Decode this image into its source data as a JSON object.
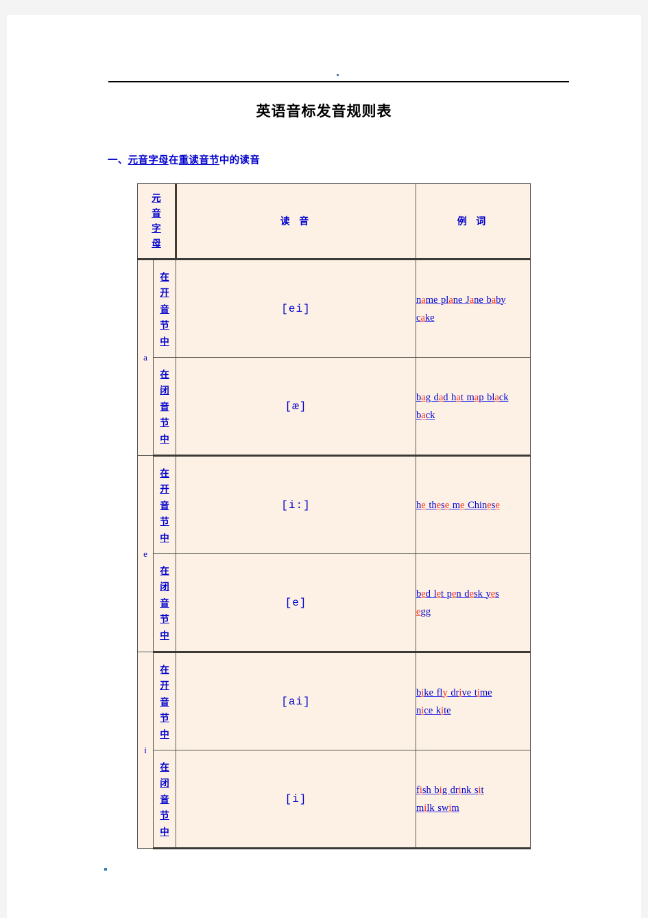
{
  "document": {
    "title": "英语音标发音规则表",
    "section_heading": {
      "prefix": "一、",
      "u1": "元音字母",
      "mid": "在",
      "u2": "重读音节",
      "suffix": "中的读音"
    }
  },
  "table": {
    "headers": {
      "vowel_letter_vertical": [
        "元",
        "音",
        "字",
        "母"
      ],
      "pronunciation": "读 音",
      "examples": "例 词"
    },
    "rows": [
      {
        "letter": "a",
        "syllable_vertical": [
          "在",
          "开",
          "音",
          "节",
          "中"
        ],
        "syllable_text": "在开音节中",
        "phonetic": "[ei]",
        "examples": [
          [
            {
              "t": "n",
              "c": "blue"
            },
            {
              "t": "a",
              "c": "red"
            },
            {
              "t": "me pl",
              "c": "blue"
            },
            {
              "t": "a",
              "c": "red"
            },
            {
              "t": "ne J",
              "c": "blue"
            },
            {
              "t": "a",
              "c": "red"
            },
            {
              "t": "ne b",
              "c": "blue"
            },
            {
              "t": "a",
              "c": "red"
            },
            {
              "t": "by",
              "c": "blue"
            }
          ],
          [
            {
              "t": "c",
              "c": "blue"
            },
            {
              "t": "a",
              "c": "red"
            },
            {
              "t": "ke",
              "c": "blue"
            }
          ]
        ],
        "examples_text": "name plane Jane baby cake"
      },
      {
        "letter": "",
        "syllable_vertical": [
          "在",
          "闭",
          "音",
          "节",
          "中"
        ],
        "syllable_text": "在闭音节中",
        "phonetic": "[æ]",
        "examples": [
          [
            {
              "t": "b",
              "c": "blue"
            },
            {
              "t": "a",
              "c": "red"
            },
            {
              "t": "g d",
              "c": "blue"
            },
            {
              "t": "a",
              "c": "red"
            },
            {
              "t": "d h",
              "c": "blue"
            },
            {
              "t": "a",
              "c": "red"
            },
            {
              "t": "t m",
              "c": "blue"
            },
            {
              "t": "a",
              "c": "red"
            },
            {
              "t": "p bl",
              "c": "blue"
            },
            {
              "t": "a",
              "c": "red"
            },
            {
              "t": "ck",
              "c": "blue"
            }
          ],
          [
            {
              "t": "b",
              "c": "blue"
            },
            {
              "t": "a",
              "c": "red"
            },
            {
              "t": "ck",
              "c": "blue"
            }
          ]
        ],
        "examples_text": "bag dad hat map black back"
      },
      {
        "letter": "e",
        "syllable_vertical": [
          "在",
          "开",
          "音",
          "节",
          "中"
        ],
        "syllable_text": "在开音节中",
        "phonetic": "[i:]",
        "examples": [
          [
            {
              "t": "h",
              "c": "blue"
            },
            {
              "t": "e",
              "c": "red"
            },
            {
              "t": " th",
              "c": "blue"
            },
            {
              "t": "e",
              "c": "red"
            },
            {
              "t": "s",
              "c": "blue"
            },
            {
              "t": "e",
              "c": "red"
            },
            {
              "t": " m",
              "c": "blue"
            },
            {
              "t": "e",
              "c": "red"
            },
            {
              "t": " Chin",
              "c": "blue"
            },
            {
              "t": "e",
              "c": "red"
            },
            {
              "t": "s",
              "c": "blue"
            },
            {
              "t": "e",
              "c": "red"
            }
          ]
        ],
        "examples_text": "he these me Chinese"
      },
      {
        "letter": "",
        "syllable_vertical": [
          "在",
          "闭",
          "音",
          "节",
          "中"
        ],
        "syllable_text": "在闭音节中",
        "phonetic": "[e]",
        "examples": [
          [
            {
              "t": "b",
              "c": "blue"
            },
            {
              "t": "e",
              "c": "red"
            },
            {
              "t": "d l",
              "c": "blue"
            },
            {
              "t": "e",
              "c": "red"
            },
            {
              "t": "t p",
              "c": "blue"
            },
            {
              "t": "e",
              "c": "red"
            },
            {
              "t": "n d",
              "c": "blue"
            },
            {
              "t": "e",
              "c": "red"
            },
            {
              "t": "sk y",
              "c": "blue"
            },
            {
              "t": "e",
              "c": "red"
            },
            {
              "t": "s",
              "c": "blue"
            }
          ],
          [
            {
              "t": "e",
              "c": "red"
            },
            {
              "t": "gg",
              "c": "blue"
            }
          ]
        ],
        "examples_text": "bed let pen desk yes egg"
      },
      {
        "letter": "i",
        "syllable_vertical": [
          "在",
          "开",
          "音",
          "节",
          "中"
        ],
        "syllable_text": "在开音节中",
        "phonetic": "[ai]",
        "examples": [
          [
            {
              "t": "b",
              "c": "blue"
            },
            {
              "t": "i",
              "c": "red"
            },
            {
              "t": "ke fl",
              "c": "blue"
            },
            {
              "t": "y",
              "c": "red"
            },
            {
              "t": " dr",
              "c": "blue"
            },
            {
              "t": "i",
              "c": "red"
            },
            {
              "t": "ve t",
              "c": "blue"
            },
            {
              "t": "i",
              "c": "red"
            },
            {
              "t": "me",
              "c": "blue"
            }
          ],
          [
            {
              "t": "n",
              "c": "blue"
            },
            {
              "t": "i",
              "c": "red"
            },
            {
              "t": "ce k",
              "c": "blue"
            },
            {
              "t": "i",
              "c": "red"
            },
            {
              "t": "te",
              "c": "blue"
            }
          ]
        ],
        "examples_text": "bike fly drive time nice kite"
      },
      {
        "letter": "",
        "syllable_vertical": [
          "在",
          "闭",
          "音",
          "节",
          "中"
        ],
        "syllable_text": "在闭音节中",
        "phonetic": "[i]",
        "examples": [
          [
            {
              "t": "f",
              "c": "blue"
            },
            {
              "t": "i",
              "c": "red"
            },
            {
              "t": "sh b",
              "c": "blue"
            },
            {
              "t": "i",
              "c": "red"
            },
            {
              "t": "g dr",
              "c": "blue"
            },
            {
              "t": "i",
              "c": "red"
            },
            {
              "t": "nk s",
              "c": "blue"
            },
            {
              "t": "i",
              "c": "red"
            },
            {
              "t": "t",
              "c": "blue"
            }
          ],
          [
            {
              "t": "m",
              "c": "blue"
            },
            {
              "t": "i",
              "c": "red"
            },
            {
              "t": "lk sw",
              "c": "blue"
            },
            {
              "t": "i",
              "c": "red"
            },
            {
              "t": "m",
              "c": "blue"
            }
          ]
        ],
        "examples_text": "milk swim"
      }
    ]
  }
}
